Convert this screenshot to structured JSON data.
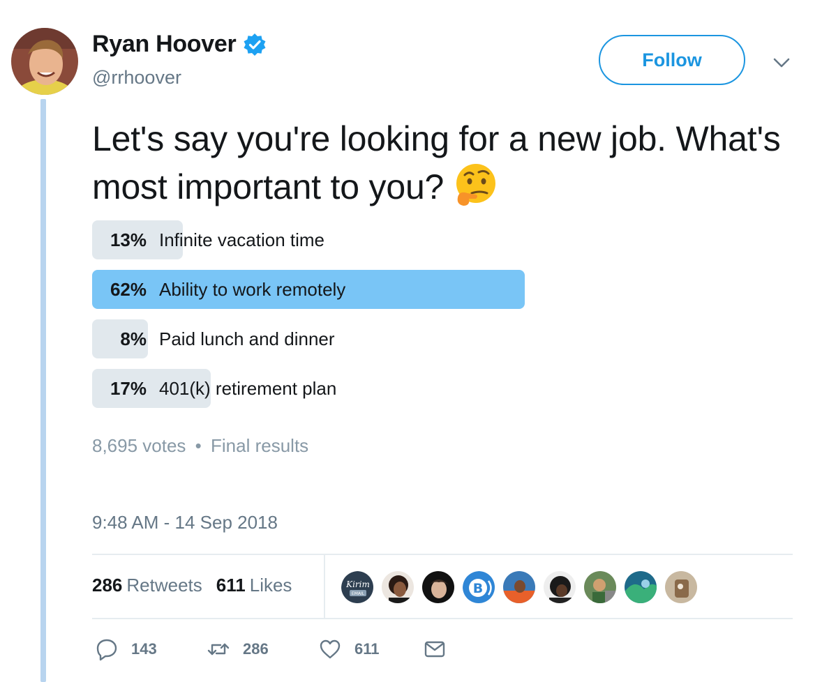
{
  "author": {
    "display_name": "Ryan Hoover",
    "handle": "@rrhoover",
    "verified": true
  },
  "follow_label": "Follow",
  "tweet_text": "Let's say you're looking for a new job. What's most important to you?",
  "emoji": "thinking-face",
  "poll": {
    "choices": [
      {
        "percent": "13%",
        "label": "Infinite vacation time",
        "value": 13,
        "winner": false
      },
      {
        "percent": "62%",
        "label": "Ability to work remotely",
        "value": 62,
        "winner": true
      },
      {
        "percent": "8%",
        "label": "Paid lunch and dinner",
        "value": 8,
        "winner": false
      },
      {
        "percent": "17%",
        "label": "401(k) retirement plan",
        "value": 17,
        "winner": false
      }
    ],
    "votes": "8,695 votes",
    "separator": "•",
    "status": "Final results"
  },
  "timestamp": "9:48 AM - 14 Sep 2018",
  "stats": {
    "retweets_count": "286",
    "retweets_label": "Retweets",
    "likes_count": "611",
    "likes_label": "Likes"
  },
  "likers": [
    "kirim-email-avatar",
    "user-avatar",
    "user-avatar",
    "b-logo-avatar",
    "user-avatar",
    "user-avatar",
    "user-avatar",
    "user-avatar",
    "user-avatar"
  ],
  "liker_logo_text": {
    "title": "Kirim",
    "sub": "EMAIL"
  },
  "actions": {
    "reply_count": "143",
    "retweet_count": "286",
    "like_count": "611"
  },
  "colors": {
    "accent": "#1b95e0",
    "winner_bar": "#79c5f6",
    "bar": "#e1e8ed",
    "thread_line": "#b8d4ef",
    "muted": "#657786"
  }
}
